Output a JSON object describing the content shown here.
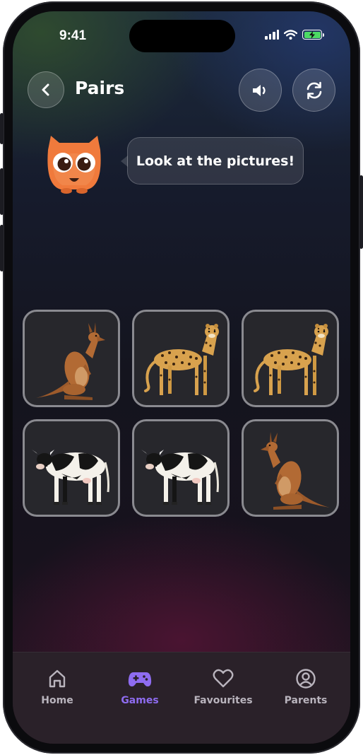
{
  "status_bar": {
    "time": "9:41",
    "battery_color": "#4cd964"
  },
  "header": {
    "title": "Pairs",
    "back_icon": "chevron-left-icon",
    "sound_icon": "speaker-icon",
    "reset_icon": "refresh-icon"
  },
  "mascot": {
    "icon": "orange-owl-mascot",
    "speech": "Look at the pictures!"
  },
  "cards": [
    {
      "animal": "kangaroo"
    },
    {
      "animal": "leopard"
    },
    {
      "animal": "leopard"
    },
    {
      "animal": "cow"
    },
    {
      "animal": "cow"
    },
    {
      "animal": "kangaroo"
    }
  ],
  "tab_bar": {
    "accent_color": "#8e6cf0",
    "items": [
      {
        "label": "Home",
        "icon": "home-icon",
        "active": false
      },
      {
        "label": "Games",
        "icon": "gamepad-icon",
        "active": true
      },
      {
        "label": "Favourites",
        "icon": "heart-icon",
        "active": false
      },
      {
        "label": "Parents",
        "icon": "user-circle-icon",
        "active": false
      }
    ]
  }
}
